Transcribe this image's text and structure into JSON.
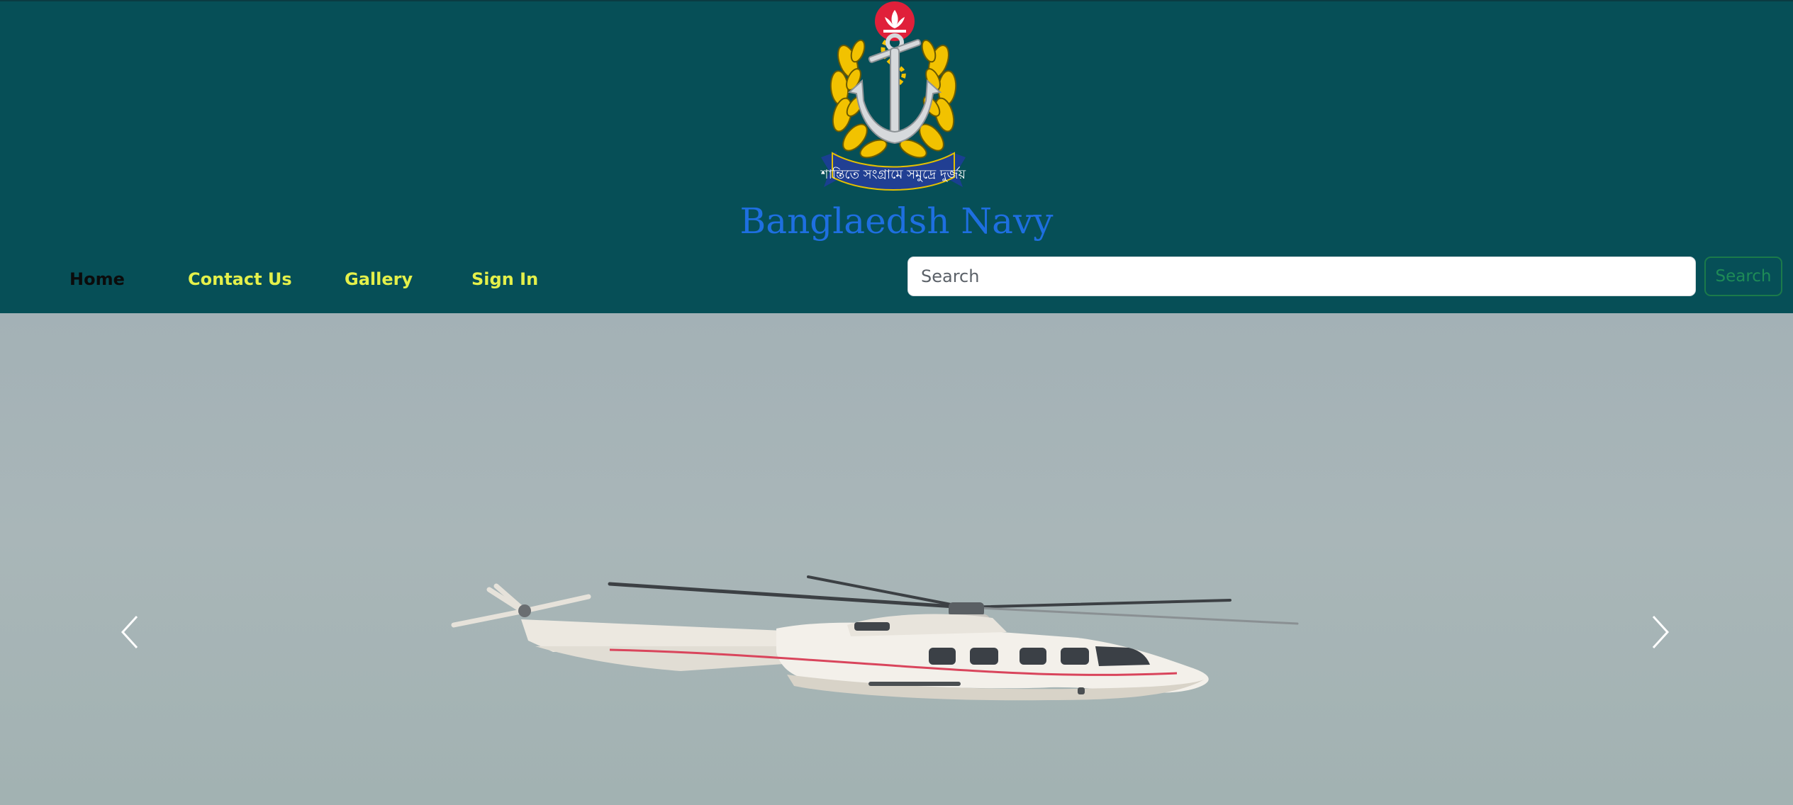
{
  "header": {
    "title": "Banglaedsh Navy",
    "emblem": {
      "icon": "navy-anchor-emblem-icon",
      "motto": "শান্তিতে সংগ্রামে সমুদ্রে দুর্জয়"
    },
    "background_color": "#064f57",
    "title_color": "#1e6fe0"
  },
  "nav": {
    "items": [
      {
        "label": "Home",
        "active": true
      },
      {
        "label": "Contact Us",
        "active": false
      },
      {
        "label": "Gallery",
        "active": false
      },
      {
        "label": "Sign In",
        "active": false
      }
    ],
    "link_color": "#e4f04a"
  },
  "search": {
    "placeholder": "Search",
    "value": "",
    "button_label": "Search"
  },
  "carousel": {
    "slide_icon": "helicopter-image",
    "prev_icon": "chevron-left-icon",
    "next_icon": "chevron-right-icon"
  }
}
